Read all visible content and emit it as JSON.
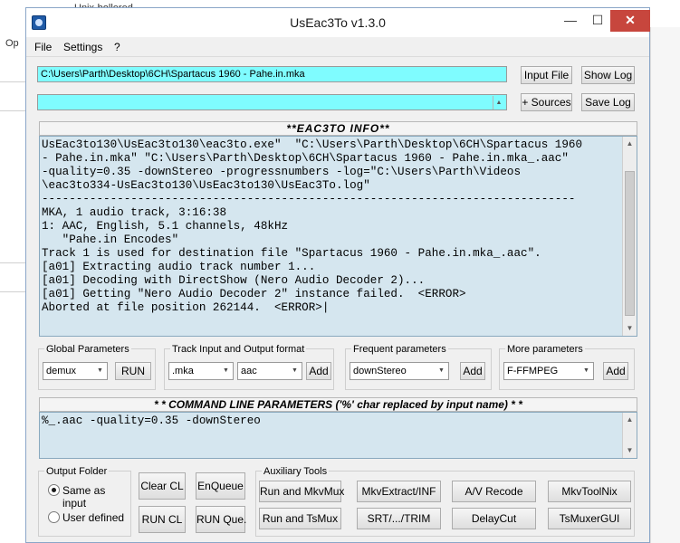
{
  "background": {
    "tab_text": "Unix-bollered",
    "partial_text": "Op"
  },
  "window": {
    "title": "UsEac3To v1.3.0",
    "minimize_glyph": "—",
    "maximize_glyph": "☐",
    "close_glyph": "✕"
  },
  "menu": [
    "File",
    "Settings",
    "?"
  ],
  "input_path": "C:\\Users\\Parth\\Desktop\\6CH\\Spartacus 1960 - Pahe.in.mka",
  "source_value": "",
  "buttons": {
    "input_file": "Input File",
    "show_log": "Show Log",
    "add_sources": "+ Sources",
    "save_log": "Save Log"
  },
  "info": {
    "header": "**EAC3TO INFO**",
    "lines": [
      "UsEac3to130\\UsEac3to130\\eac3to.exe\"  \"C:\\Users\\Parth\\Desktop\\6CH\\Spartacus 1960",
      "- Pahe.in.mka\" \"C:\\Users\\Parth\\Desktop\\6CH\\Spartacus 1960 - Pahe.in.mka_.aac\"",
      "-quality=0.35 -downStereo -progressnumbers -log=\"C:\\Users\\Parth\\Videos",
      "\\eac3to334-UsEac3to130\\UsEac3to130\\UsEac3To.log\"",
      "------------------------------------------------------------------------------",
      "MKA, 1 audio track, 3:16:38",
      "1: AAC, English, 5.1 channels, 48kHz",
      "   \"Pahe.in Encodes\"",
      "Track 1 is used for destination file \"Spartacus 1960 - Pahe.in.mka_.aac\".",
      "[a01] Extracting audio track number 1...",
      "[a01] Decoding with DirectShow (Nero Audio Decoder 2)...",
      "[a01] Getting \"Nero Audio Decoder 2\" instance failed.  <ERROR>",
      "Aborted at file position 262144.  <ERROR>|"
    ]
  },
  "params": {
    "global": {
      "label": "Global Parameters",
      "value": "demux",
      "run": "RUN"
    },
    "track": {
      "label": "Track Input and Output format",
      "input": ".mka",
      "output": "aac",
      "add": "Add"
    },
    "frequent": {
      "label": "Frequent parameters",
      "value": "downStereo",
      "add": "Add"
    },
    "more": {
      "label": "More parameters",
      "value": "F-FFMPEG",
      "add": "Add"
    }
  },
  "command": {
    "header": "* * COMMAND LINE PARAMETERS ('%' char replaced by input name) * *",
    "text": "%_.aac -quality=0.35 -downStereo"
  },
  "output_folder": {
    "label": "Output Folder",
    "same_as_input": "Same as input",
    "user_defined": "User defined"
  },
  "cl_buttons": {
    "clear_cl": "Clear CL",
    "enqueue": "EnQueue",
    "run_cl": "RUN CL",
    "run_que": "RUN Que."
  },
  "aux": {
    "label": "Auxiliary Tools",
    "row1": [
      "Run and MkvMux",
      "MkvExtract/INF",
      "A/V Recode",
      "MkvToolNix"
    ],
    "row2": [
      "Run and TsMux",
      "SRT/.../TRIM",
      "DelayCut",
      "TsMuxerGUI"
    ]
  },
  "icons": {
    "app": "app-icon",
    "arrow": "dropdown-arrow-icon"
  }
}
